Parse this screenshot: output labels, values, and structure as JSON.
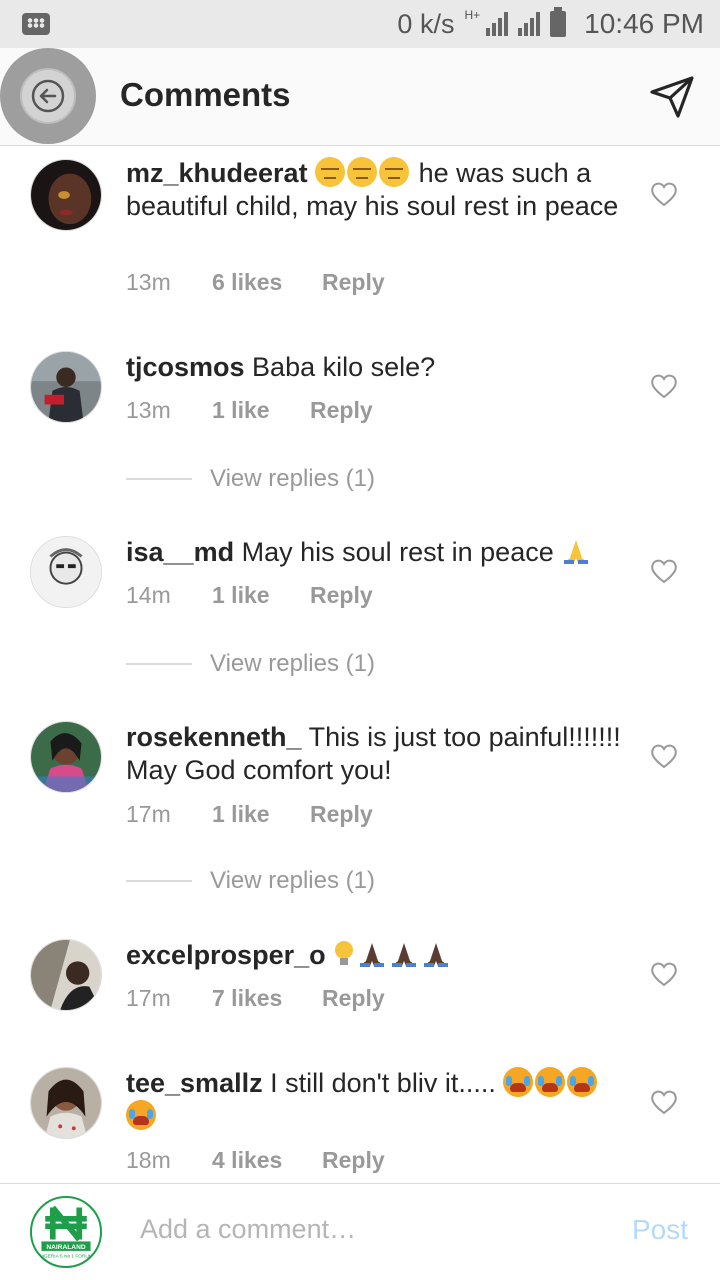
{
  "status_bar": {
    "net_speed": "0 k/s",
    "network_type": "H+",
    "time": "10:46 PM"
  },
  "header": {
    "title": "Comments",
    "back_icon": "arrow-left-icon",
    "send_icon": "send-icon"
  },
  "comments": [
    {
      "username": "mz_khudeerat",
      "emoji_before": [
        "expressionless",
        "expressionless",
        "expressionless"
      ],
      "text": " he was such a beautiful child, may his soul rest in peace",
      "time": "13m",
      "likes": "6 likes",
      "reply_label": "Reply",
      "view_replies": ""
    },
    {
      "username": "tjcosmos",
      "text": " Baba kilo sele?",
      "time": "13m",
      "likes": "1 like",
      "reply_label": "Reply",
      "view_replies": "View replies (1)"
    },
    {
      "username": "isa__md",
      "text": " May his soul rest in peace ",
      "emoji_after": [
        "folded-hands"
      ],
      "time": "14m",
      "likes": "1 like",
      "reply_label": "Reply",
      "view_replies": "View replies (1)"
    },
    {
      "username": "rosekenneth_",
      "text": " This is just too painful!!!!!!! May God comfort you!",
      "time": "17m",
      "likes": "1 like",
      "reply_label": "Reply",
      "view_replies": "View replies (1)"
    },
    {
      "username": "excelprosper_o",
      "emoji_after": [
        "light-bulb",
        "folded-hands",
        "folded-hands",
        "folded-hands"
      ],
      "text": " ",
      "time": "17m",
      "likes": "7 likes",
      "reply_label": "Reply",
      "view_replies": ""
    },
    {
      "username": "tee_smallz",
      "text": " I still don't bliv it..... ",
      "emoji_after": [
        "loudly-crying",
        "loudly-crying",
        "loudly-crying",
        "loudly-crying"
      ],
      "time": "18m",
      "likes": "4 likes",
      "reply_label": "Reply",
      "view_replies": ""
    }
  ],
  "composer": {
    "avatar_brand": "NAIRALAND",
    "avatar_tagline": "NIGERIA'S No 1 FORUM",
    "placeholder": "Add a comment…",
    "post_label": "Post"
  },
  "colors": {
    "accent_link": "#b3dbf8",
    "meta_text": "#999999",
    "header_bg": "#fafafa",
    "status_bg": "#e9e9e9"
  }
}
